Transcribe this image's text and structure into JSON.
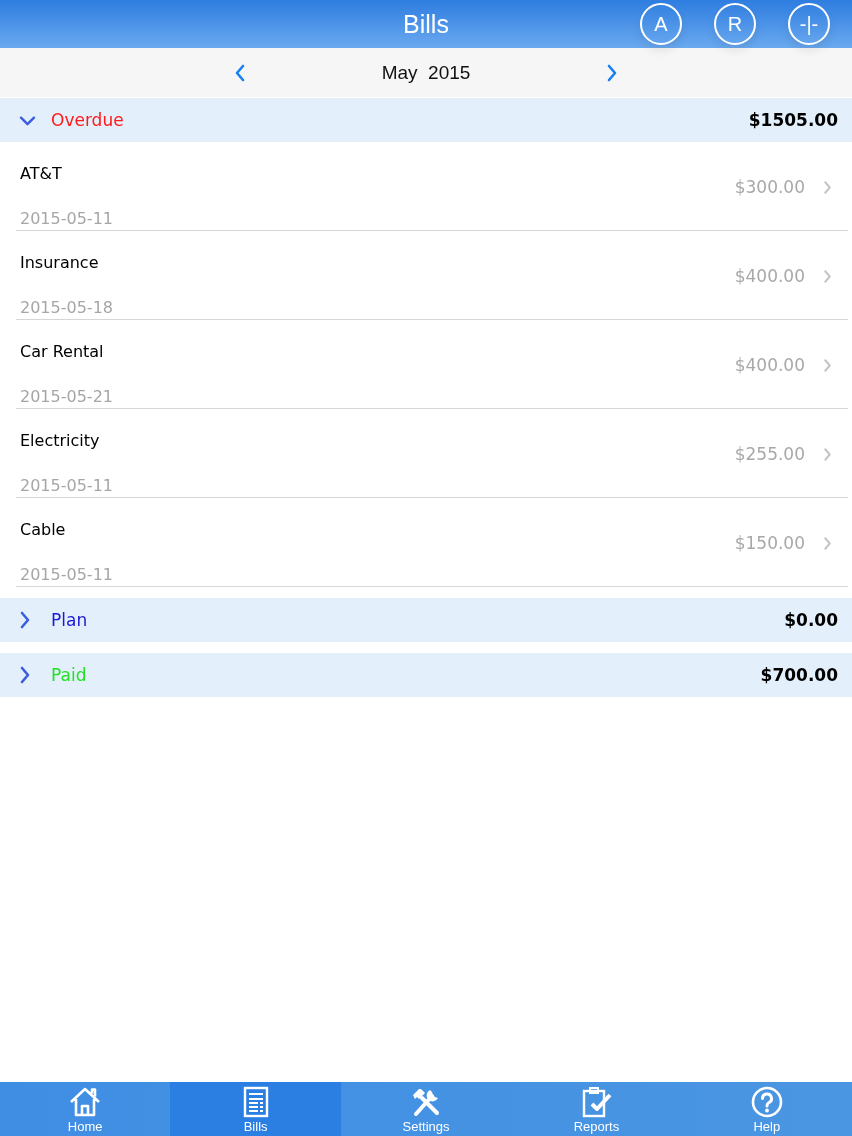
{
  "header": {
    "title": "Bills",
    "actions": [
      {
        "label": "A"
      },
      {
        "label": "R"
      },
      {
        "label": "-|-"
      }
    ]
  },
  "month_nav": {
    "label": "May  2015"
  },
  "sections": [
    {
      "title": "Overdue",
      "total": "$1505.00",
      "expanded": true,
      "color": "#ff1a1a",
      "bills": [
        {
          "name": "AT&T",
          "date": "2015-05-11",
          "amount": "$300.00"
        },
        {
          "name": "Insurance",
          "date": "2015-05-18",
          "amount": "$400.00"
        },
        {
          "name": "Car Rental",
          "date": "2015-05-21",
          "amount": "$400.00"
        },
        {
          "name": "Electricity",
          "date": "2015-05-11",
          "amount": "$255.00"
        },
        {
          "name": "Cable",
          "date": "2015-05-11",
          "amount": "$150.00"
        }
      ]
    },
    {
      "title": "Plan",
      "total": "$0.00",
      "expanded": false,
      "color": "#1a1ad8"
    },
    {
      "title": "Paid",
      "total": "$700.00",
      "expanded": false,
      "color": "#22e022"
    }
  ],
  "tab_bar": [
    {
      "label": "Home",
      "kind": "home",
      "selected": false
    },
    {
      "label": "Bills",
      "kind": "bills",
      "selected": true
    },
    {
      "label": "Settings",
      "kind": "settings",
      "selected": false
    },
    {
      "label": "Reports",
      "kind": "reports",
      "selected": false
    },
    {
      "label": "Help",
      "kind": "help",
      "selected": false
    }
  ]
}
